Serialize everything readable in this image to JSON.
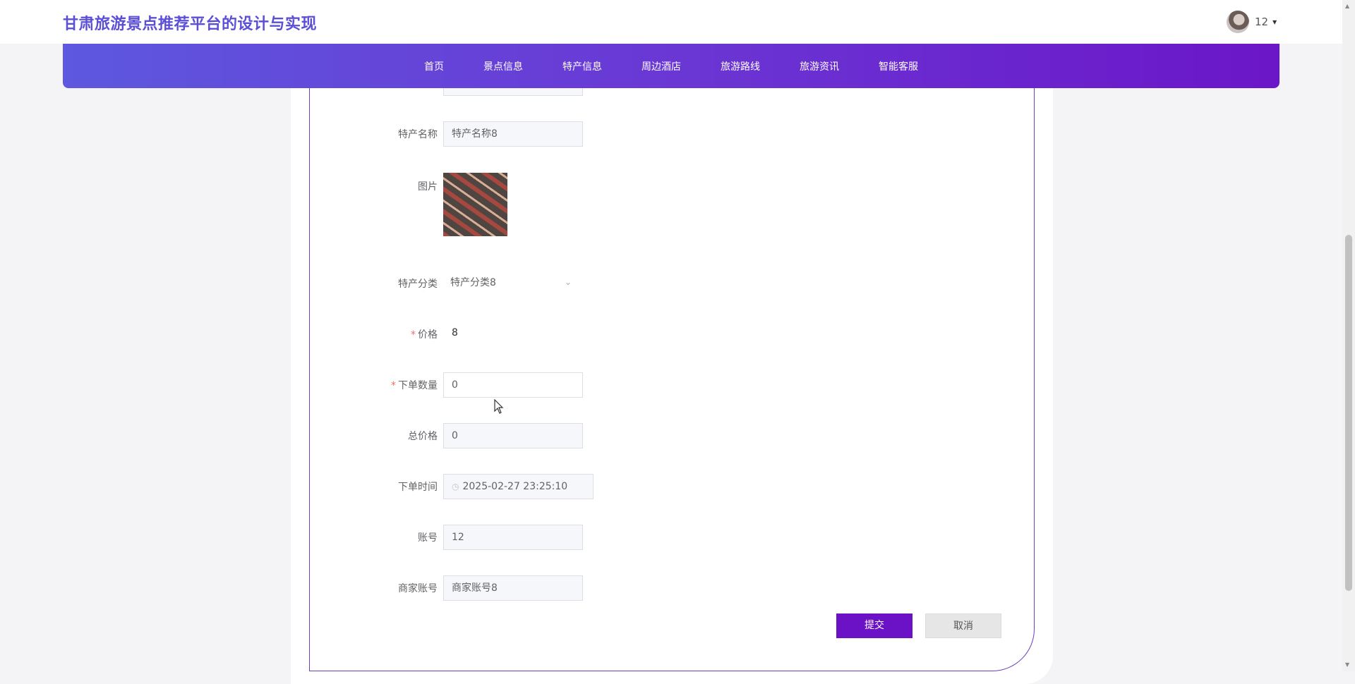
{
  "header": {
    "site_title": "甘肃旅游景点推荐平台的设计与实现",
    "user_name": "12",
    "caret": "▾"
  },
  "nav": {
    "items": [
      "首页",
      "景点信息",
      "特产信息",
      "周边酒店",
      "旅游路线",
      "旅游资讯",
      "智能客服"
    ]
  },
  "form": {
    "specialty_name": {
      "label": "特产名称",
      "value": "特产名称8"
    },
    "image": {
      "label": "图片"
    },
    "specialty_category": {
      "label": "特产分类",
      "value": "特产分类8"
    },
    "price": {
      "required_mark": "*",
      "label": "价格",
      "value": "8"
    },
    "order_quantity": {
      "required_mark": "*",
      "label": "下单数量",
      "value": "0"
    },
    "total_price": {
      "label": "总价格",
      "value": "0"
    },
    "order_time": {
      "label": "下单时间",
      "value": "2025-02-27 23:25:10"
    },
    "account": {
      "label": "账号",
      "value": "12"
    },
    "merchant_account": {
      "label": "商家账号",
      "value": "商家账号8"
    }
  },
  "buttons": {
    "submit": "提交",
    "cancel": "取消"
  },
  "icons": {
    "select_arrow": "⌄",
    "clock": "◷",
    "scroll_up": "▲",
    "scroll_down": "▼"
  },
  "colors": {
    "brand_title": "#5b4fd6",
    "nav_gradient_start": "#5d58df",
    "nav_gradient_end": "#6b16c8",
    "submit_button": "#6b12c7",
    "required": "#f56c6c"
  }
}
